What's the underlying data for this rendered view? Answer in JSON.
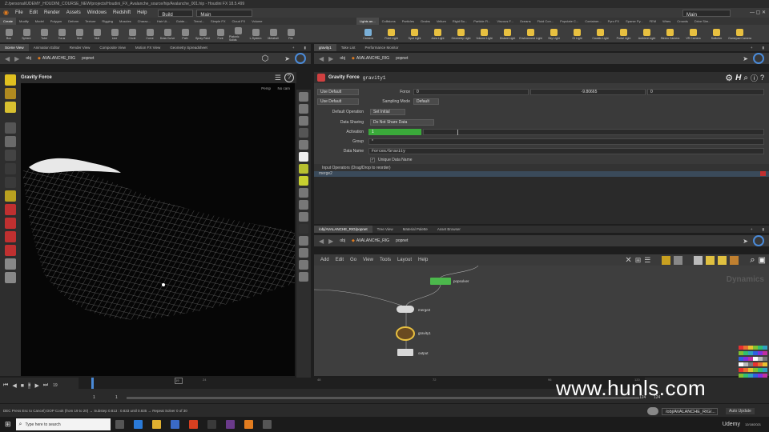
{
  "window_title": "Z:/personal/UDEMY_HOUDINI_COURSE_NEW/projects/Houdini_FX_Avalanche_source/hip/Avalanche_001.hip - Houdini FX 18.5.499",
  "menu": [
    "File",
    "Edit",
    "Render",
    "Assets",
    "Windows",
    "Redshift",
    "Help"
  ],
  "desktop_combo": "Build",
  "main_combo": "Main",
  "right_combo": "Main",
  "shelf_tabs_left": [
    "Create",
    "Modify",
    "Model",
    "Polygon",
    "Deform",
    "Texture",
    "Rigging",
    "Muscles",
    "Charac...",
    "Hair Ut...",
    "Guide...",
    "Terrai...",
    "Simple FX",
    "Cloud FX",
    "Volume"
  ],
  "shelf_tabs_right": [
    "Lights an...",
    "Collisions",
    "Particles",
    "Grains",
    "Vellum",
    "Rigid Bo...",
    "Particle Fl...",
    "Viscous F...",
    "Oceans",
    "Fluid Con...",
    "Populate C...",
    "Container...",
    "Pyro FX",
    "Sparse Py...",
    "FEM",
    "Wires",
    "Crowds",
    "Drive Sim..."
  ],
  "shelf_tools_left": [
    "Box",
    "Sphere",
    "Tube",
    "Torus",
    "Grid",
    "Null",
    "Line",
    "Circle",
    "Curve",
    "Draw Curve",
    "Path",
    "Spray Paint",
    "Font",
    "Platonic Solids",
    "L-System",
    "Metaball",
    "File"
  ],
  "shelf_tools_right": [
    "Camera",
    "Point Light",
    "Spot Light",
    "Area Light",
    "Geometry Light",
    "Volume Light",
    "Distant Light",
    "Environment Light",
    "Sky Light",
    "GI Light",
    "Caustic Light",
    "Portal Light",
    "Ambient Light",
    "Stereo Camera",
    "VR Camera",
    "Switcher",
    "Gamepad Camera"
  ],
  "left_pane_tabs": [
    "Scene View",
    "Animation Editor",
    "Render View",
    "Composite View",
    "Motion FX View",
    "Geometry Spreadsheet"
  ],
  "right_pane_tabs": [
    "gravity1",
    "Take List",
    "Performance Monitor"
  ],
  "path": {
    "root": "obj",
    "node": "AVALANCHE_RIG",
    "net": "popnet"
  },
  "viewport": {
    "title": "Gravity Force",
    "persp": "Persp",
    "cam": "No cam"
  },
  "params": {
    "node_type": "Gravity Force",
    "node_name": "gravity1",
    "use_default_1": "Use Default",
    "force_label": "Force",
    "force_values": [
      "0",
      "-9.80665",
      "0"
    ],
    "use_default_2": "Use Default",
    "sampling_label": "Sampling Mode",
    "sampling_value": "Default",
    "default_op_label": "Default Operation",
    "default_op_value": "Set Initial",
    "data_sharing_label": "Data Sharing",
    "data_sharing_value": "Do Not Share Data",
    "activation_label": "Activation",
    "activation_value": "1",
    "group_label": "Group",
    "group_value": "*",
    "data_name_label": "Data Name",
    "data_name_value": "Forces/Gravity",
    "unique_label": "Unique Data Name",
    "input_ops_label": "Input Operators (Drag/Drop to reorder)",
    "input_op_item": "merge2"
  },
  "network_tabs": [
    "/obj/AVALANCHE_RIG/popnet",
    "Tree View",
    "Material Palette",
    "Asset Browser"
  ],
  "network_menu": [
    "Add",
    "Edit",
    "Go",
    "View",
    "Tools",
    "Layout",
    "Help"
  ],
  "network_context": "Dynamics",
  "nodes": {
    "popsolver": "popsolver",
    "merge": "merge2",
    "gravity": "gravity1",
    "output": "output"
  },
  "timeline": {
    "frame": "19",
    "start": "1",
    "start2": "1",
    "end": "124",
    "end2": "124",
    "ticks": [
      "24",
      "48",
      "72",
      "96",
      "120"
    ]
  },
  "status_text": "DEC Press Esc to Cancel) DOP Cook (from 19 to 20) → Substep 0.813 : 0.833 until 0.835 → Repeat Solver 0 of 30",
  "status_right": "/obj/AVALANCHE_RIG/...",
  "auto_update": "Auto Update",
  "taskbar_search": "Type here to search",
  "clock_date": "12/18/2021",
  "watermark": "www.hunls.com",
  "udemy": "Udemy",
  "colors": {
    "accent": "#e27c1f",
    "activation": "#3aaa3a",
    "node_green": "#4cb84c",
    "viewport_bg": "#060606"
  }
}
